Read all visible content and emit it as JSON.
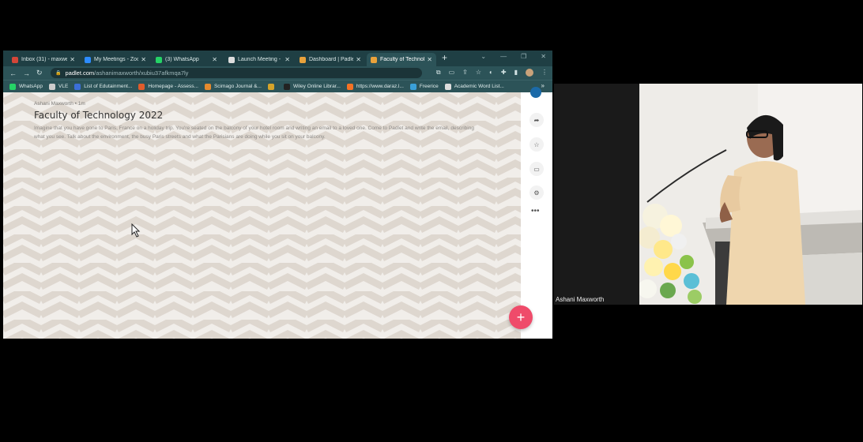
{
  "browser": {
    "tabs": [
      {
        "label": "Inbox (31) - maxwe",
        "color": "#d44638",
        "active": false
      },
      {
        "label": "My Meetings - Zoo",
        "color": "#2d8cff",
        "active": false
      },
      {
        "label": "(3) WhatsApp",
        "color": "#25d366",
        "active": false
      },
      {
        "label": "Launch Meeting - Z",
        "color": "#dddddd",
        "active": false
      },
      {
        "label": "Dashboard | Padlet",
        "color": "#e9a23b",
        "active": false
      },
      {
        "label": "Faculty of Technolo",
        "color": "#e9a23b",
        "active": true
      }
    ],
    "url_host": "padlet.com",
    "url_path": "/ashanimaxworth/xubiu37afkmqa7ly",
    "bookmarks": [
      {
        "label": "WhatsApp",
        "color": "#25d366"
      },
      {
        "label": "VLE",
        "color": "#cccccc"
      },
      {
        "label": "List of Edutainment...",
        "color": "#3b6fd8"
      },
      {
        "label": "Homepage - Assess...",
        "color": "#e05c2b"
      },
      {
        "label": "Scimago Journal &...",
        "color": "#e58a2e"
      },
      {
        "label": "",
        "color": "#d6a42a"
      },
      {
        "label": "Wiley Online Librar...",
        "color": "#222222"
      },
      {
        "label": "https://www.daraz.l...",
        "color": "#f57224"
      },
      {
        "label": "Freerice",
        "color": "#3aa0d8"
      },
      {
        "label": "Academic Word List...",
        "color": "#dddddd"
      }
    ],
    "bookmarks_more": "»"
  },
  "padlet": {
    "author": "Ashani Maxworth • 1m",
    "title": "Faculty of Technology 2022",
    "description": "Imagine that you have gone to Paris, France on a holiday trip. You're seated on the balcony of your hotel room and writing an email to a loved one. Come to Padlet and write the email, describing what you see. Talk about the environment, the busy Paris streets and what the Parisians are doing while you sit on your balcony.",
    "fab_label": "+",
    "rail_more": "•••"
  },
  "zoom": {
    "participant_name": "Ashani Maxworth"
  },
  "colors": {
    "browser_dark": "#1f3f44",
    "browser_bar": "#2c5358",
    "accent_pink": "#ef4b6a"
  }
}
